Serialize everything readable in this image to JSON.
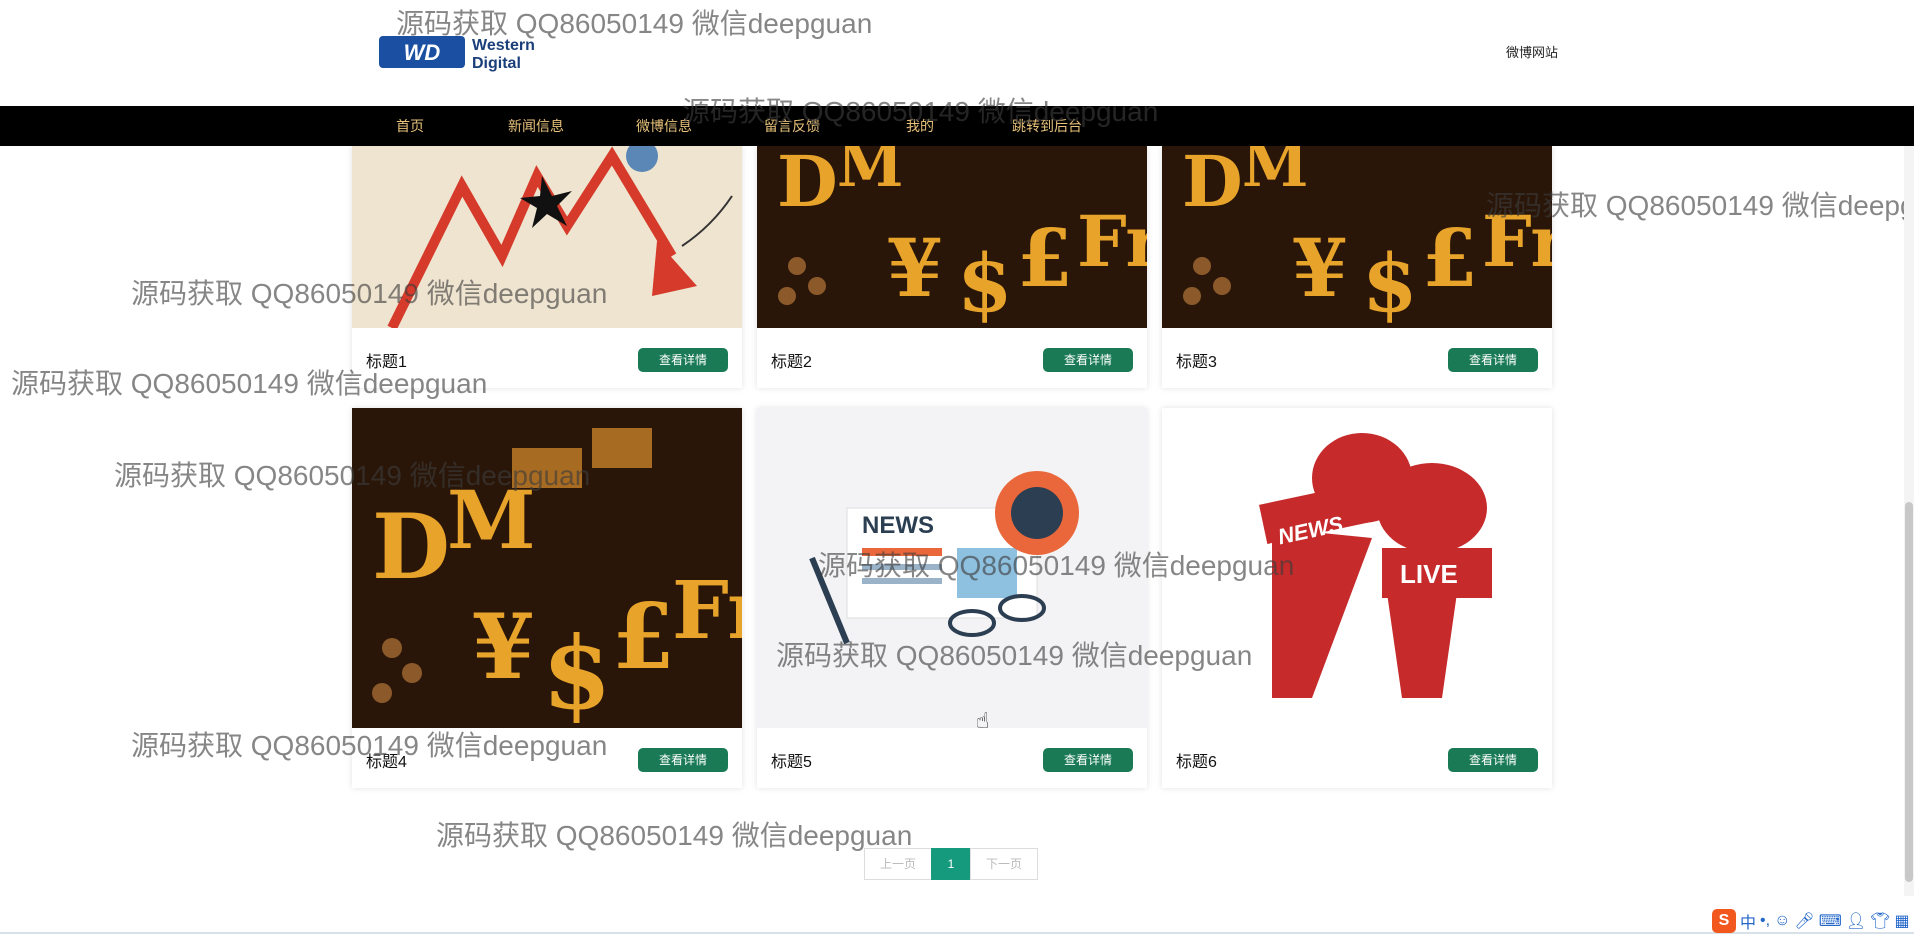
{
  "header": {
    "logo_text": "WD Western Digital",
    "site_name": "微博网站"
  },
  "nav": [
    {
      "label": "首页"
    },
    {
      "label": "新闻信息"
    },
    {
      "label": "微博信息"
    },
    {
      "label": "留言反馈"
    },
    {
      "label": "我的"
    },
    {
      "label": "跳转到后台"
    }
  ],
  "cards": [
    {
      "title": "标题1",
      "button": "查看详情",
      "image": "stock-down-chart"
    },
    {
      "title": "标题2",
      "button": "查看详情",
      "image": "currency-symbols"
    },
    {
      "title": "标题3",
      "button": "查看详情",
      "image": "currency-symbols"
    },
    {
      "title": "标题4",
      "button": "查看详情",
      "image": "currency-symbols"
    },
    {
      "title": "标题5",
      "button": "查看详情",
      "image": "news-illustration",
      "news_text": "NEWS"
    },
    {
      "title": "标题6",
      "button": "查看详情",
      "image": "news-microphones",
      "news_text": "NEWS",
      "live_text": "LIVE"
    }
  ],
  "pagination": {
    "prev": "上一页",
    "current": "1",
    "next": "下一页"
  },
  "watermark": "源码获取 QQ86050149 微信deepguan",
  "taskbar": {
    "ime_label": "中",
    "ime_logo": "S"
  },
  "colors": {
    "nav_bg": "#000000",
    "nav_text": "#e8c27a",
    "button_green": "#1a7a55",
    "pager_active": "#169a7d"
  }
}
